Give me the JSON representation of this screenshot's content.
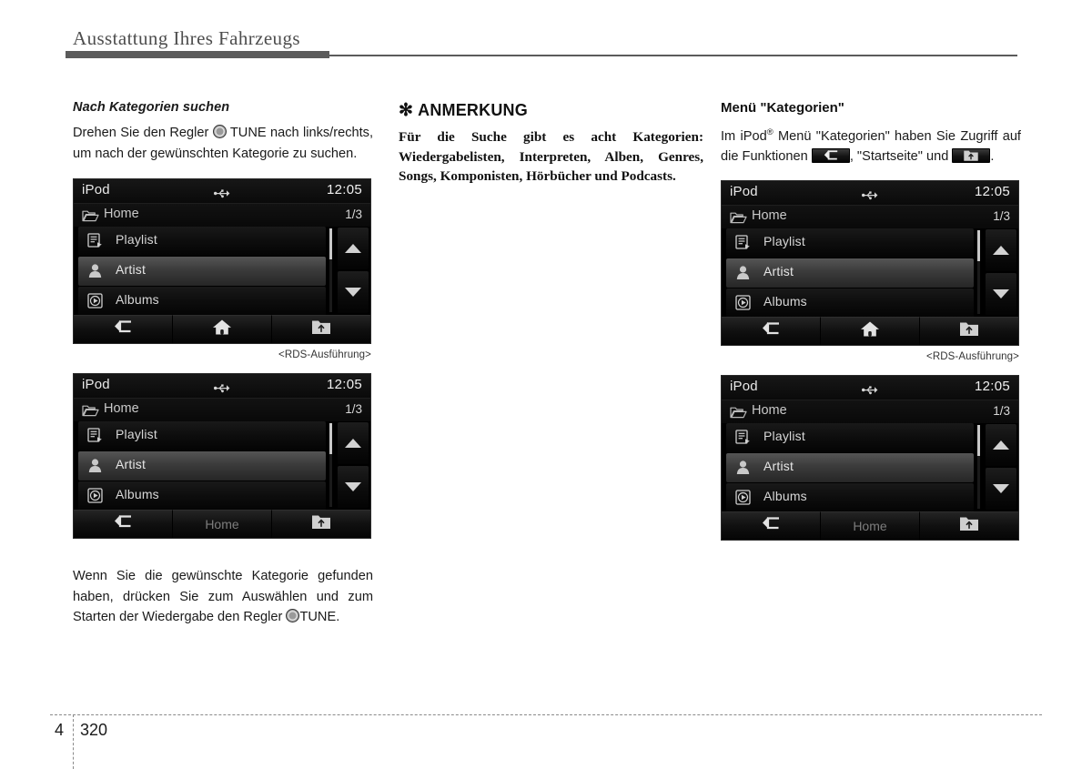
{
  "header": {
    "title": "Ausstattung Ihres Fahrzeugs"
  },
  "left_column": {
    "sub_head": "Nach Kategorien suchen",
    "intro_text_before_knob": "Drehen Sie den Regler",
    "intro_text_after_knob": "TUNE nach links/rechts, um nach der gewünschten Kategorie zu suchen.",
    "closing_text_before_knob": "Wenn Sie die gewünschte Kategorie gefunden haben, drücken Sie zum Auswählen und zum Starten der Wiedergabe den Regler",
    "closing_text_after_knob": "TUNE.",
    "caption_rds": "<RDS-Ausführung>"
  },
  "note": {
    "asterisk": "✻",
    "title": "ANMERKUNG",
    "body": "Für die Suche gibt es acht Kategorien: Wiedergabelisten, Interpreten, Alben, Genres, Songs, Komponisten, Hörbücher und Podcasts."
  },
  "right_column": {
    "sec_head": "Menü \"Kategorien\"",
    "text_part1": "Im iPod",
    "text_reg": "®",
    "text_part2": " Menü \"Kategorien\" haben Sie Zugriff auf die Funktionen",
    "text_part3": ", \"Startseite\" und",
    "text_part4": ".",
    "chip1_icon": "back-arrow-icon",
    "chip2_icon": "folder-up-icon",
    "caption_rds": "<RDS-Ausführung>"
  },
  "screens": [
    {
      "id": "left-top",
      "status_title": "iPod",
      "usb_icon": "usb-icon",
      "clock": "12:05",
      "folder_icon": "folder-icon",
      "path_label": "Home",
      "path_count": "1/3",
      "rows": [
        {
          "label": "Playlist",
          "icon": "playlist-icon",
          "selected": false
        },
        {
          "label": "Artist",
          "icon": "artist-icon",
          "selected": true
        },
        {
          "label": "Albums",
          "icon": "albums-icon",
          "selected": false
        }
      ],
      "scroll_up_icon": "triangle-up-icon",
      "scroll_down_icon": "triangle-down-icon",
      "bottom": [
        {
          "type": "icon",
          "icon": "back-arrow-icon",
          "label": ""
        },
        {
          "type": "icon",
          "icon": "home-icon",
          "label": ""
        },
        {
          "type": "icon",
          "icon": "folder-up-icon",
          "label": ""
        }
      ]
    },
    {
      "id": "left-bottom",
      "status_title": "iPod",
      "usb_icon": "usb-icon",
      "clock": "12:05",
      "folder_icon": "folder-icon",
      "path_label": "Home",
      "path_count": "1/3",
      "rows": [
        {
          "label": "Playlist",
          "icon": "playlist-icon",
          "selected": false
        },
        {
          "label": "Artist",
          "icon": "artist-icon",
          "selected": true
        },
        {
          "label": "Albums",
          "icon": "albums-icon",
          "selected": false
        }
      ],
      "scroll_up_icon": "triangle-up-icon",
      "scroll_down_icon": "triangle-down-icon",
      "bottom": [
        {
          "type": "icon",
          "icon": "back-arrow-icon",
          "label": ""
        },
        {
          "type": "text",
          "icon": "",
          "label": "Home"
        },
        {
          "type": "icon",
          "icon": "folder-up-icon",
          "label": ""
        }
      ]
    },
    {
      "id": "right-top",
      "status_title": "iPod",
      "usb_icon": "usb-icon",
      "clock": "12:05",
      "folder_icon": "folder-icon",
      "path_label": "Home",
      "path_count": "1/3",
      "rows": [
        {
          "label": "Playlist",
          "icon": "playlist-icon",
          "selected": false
        },
        {
          "label": "Artist",
          "icon": "artist-icon",
          "selected": true
        },
        {
          "label": "Albums",
          "icon": "albums-icon",
          "selected": false
        }
      ],
      "scroll_up_icon": "triangle-up-icon",
      "scroll_down_icon": "triangle-down-icon",
      "bottom": [
        {
          "type": "icon",
          "icon": "back-arrow-icon",
          "label": ""
        },
        {
          "type": "icon",
          "icon": "home-icon",
          "label": ""
        },
        {
          "type": "icon",
          "icon": "folder-up-icon",
          "label": ""
        }
      ]
    },
    {
      "id": "right-bottom",
      "status_title": "iPod",
      "usb_icon": "usb-icon",
      "clock": "12:05",
      "folder_icon": "folder-icon",
      "path_label": "Home",
      "path_count": "1/3",
      "rows": [
        {
          "label": "Playlist",
          "icon": "playlist-icon",
          "selected": false
        },
        {
          "label": "Artist",
          "icon": "artist-icon",
          "selected": true
        },
        {
          "label": "Albums",
          "icon": "albums-icon",
          "selected": false
        }
      ],
      "scroll_up_icon": "triangle-up-icon",
      "scroll_down_icon": "triangle-down-icon",
      "bottom": [
        {
          "type": "icon",
          "icon": "back-arrow-icon",
          "label": ""
        },
        {
          "type": "text",
          "icon": "",
          "label": "Home"
        },
        {
          "type": "icon",
          "icon": "folder-up-icon",
          "label": ""
        }
      ]
    }
  ],
  "footer": {
    "chapter": "4",
    "page": "320"
  }
}
